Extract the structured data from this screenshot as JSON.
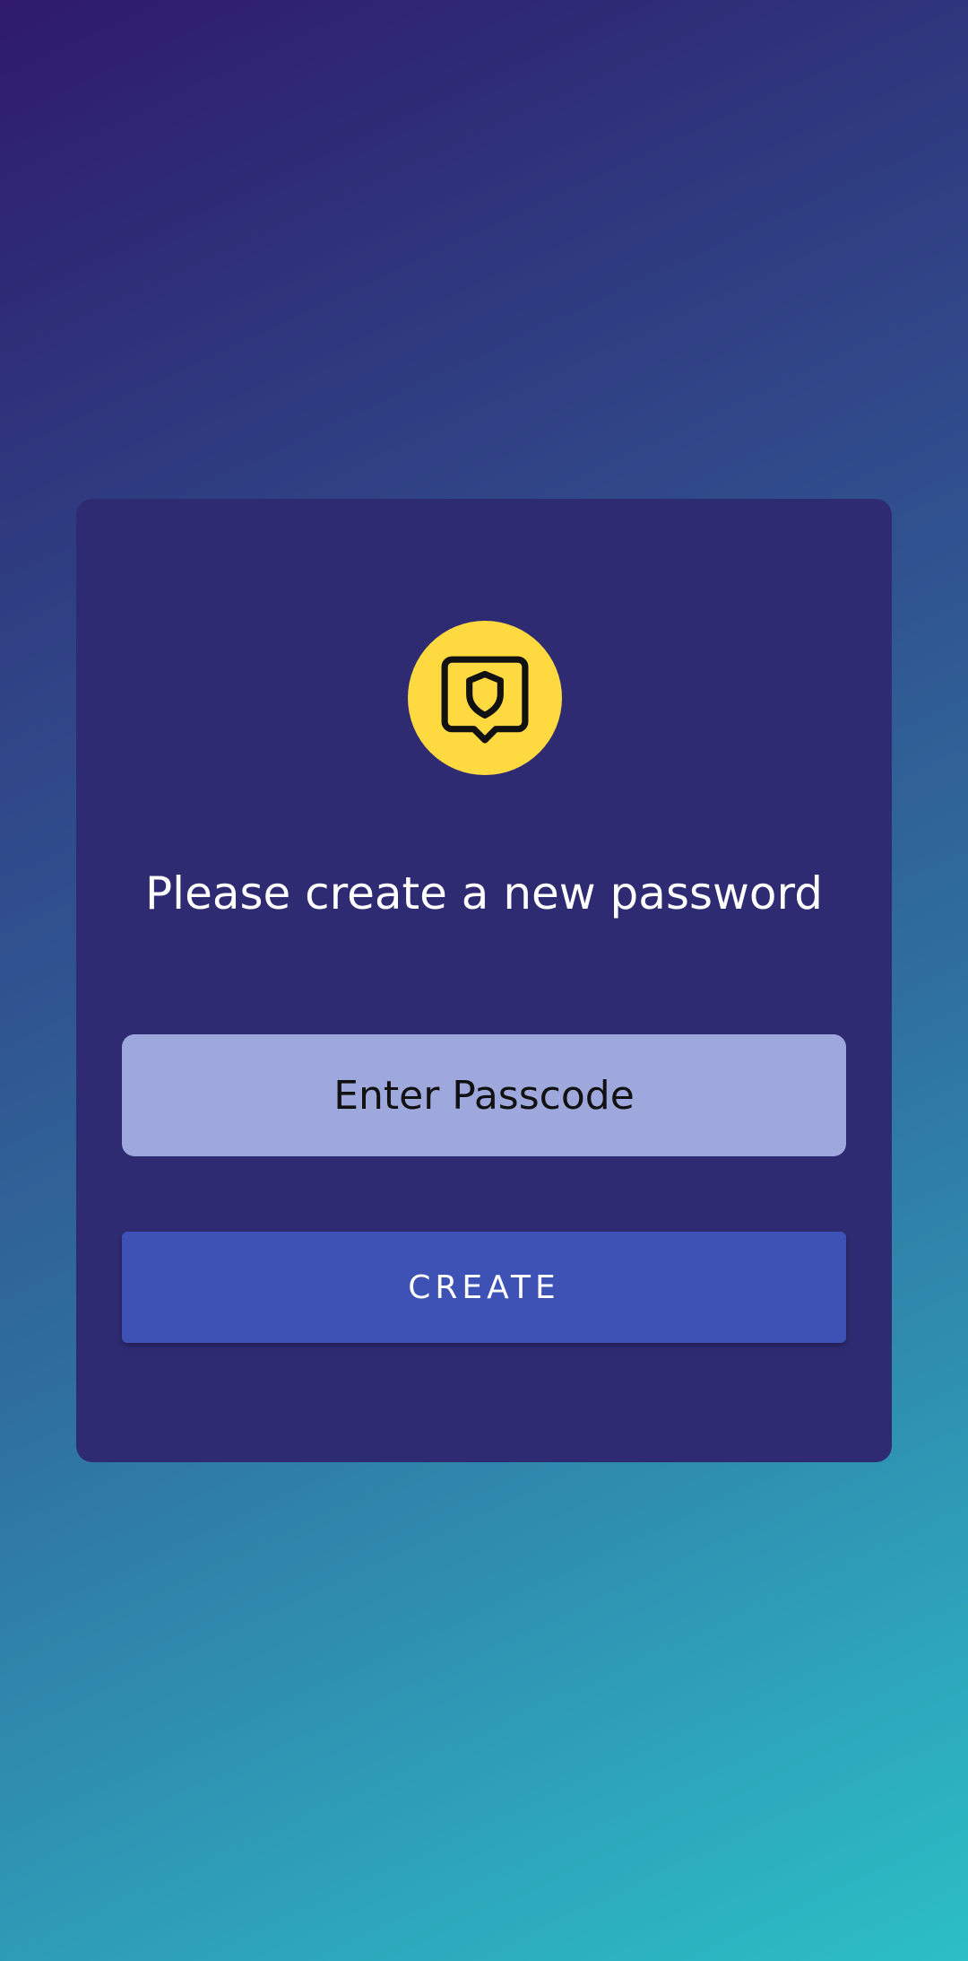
{
  "dialog": {
    "title": "Please create a new password",
    "passcode_placeholder": "Enter Passcode",
    "passcode_value": "",
    "create_label": "CREATE",
    "icon": "shield-message-icon"
  },
  "colors": {
    "card_background": "#2f2b73",
    "icon_circle": "#ffd940",
    "input_background": "#9ea8dc",
    "button_background": "#3e52b6",
    "text_light": "#ffffff",
    "text_dark": "#111111"
  }
}
